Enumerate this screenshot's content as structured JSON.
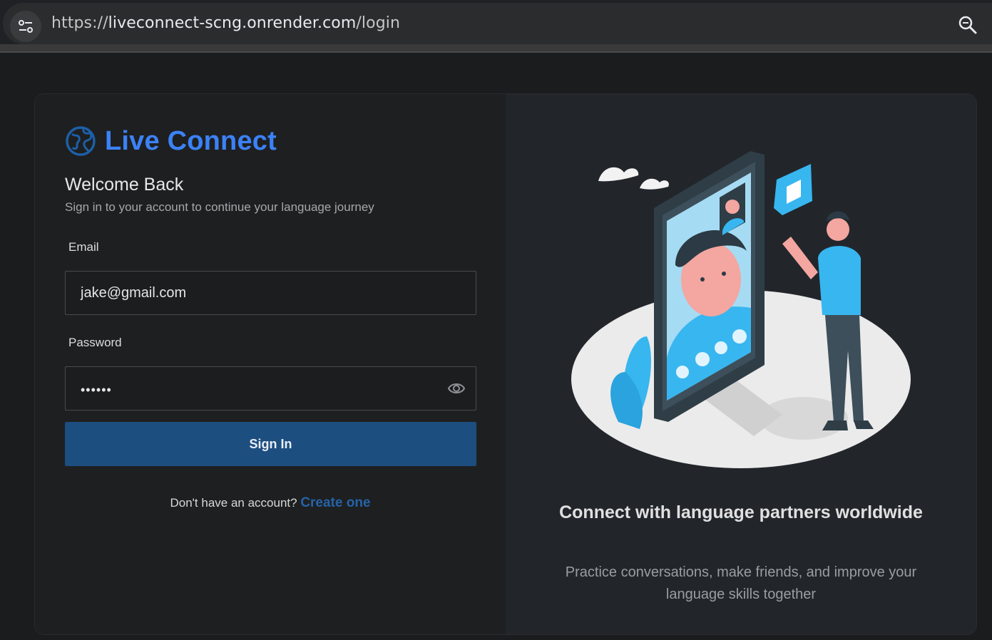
{
  "browser": {
    "url_scheme": "https://",
    "url_host": "liveconnect-scng.onrender.com",
    "url_path": "/login"
  },
  "brand": {
    "name": "Live Connect",
    "color": "#3b82f6"
  },
  "login": {
    "title": "Welcome Back",
    "subtitle": "Sign in to your account to continue your language journey",
    "email_label": "Email",
    "email_value": "jake@gmail.com",
    "password_label": "Password",
    "password_masked": "••••••",
    "submit_label": "Sign In",
    "signup_prompt": "Don't have an account?",
    "signup_link": "Create one"
  },
  "promo": {
    "title": "Connect with language partners worldwide",
    "description": "Practice conversations, make friends, and improve your language skills together"
  },
  "colors": {
    "button": "#1d4e80",
    "illustration_accent": "#38b6f0"
  }
}
